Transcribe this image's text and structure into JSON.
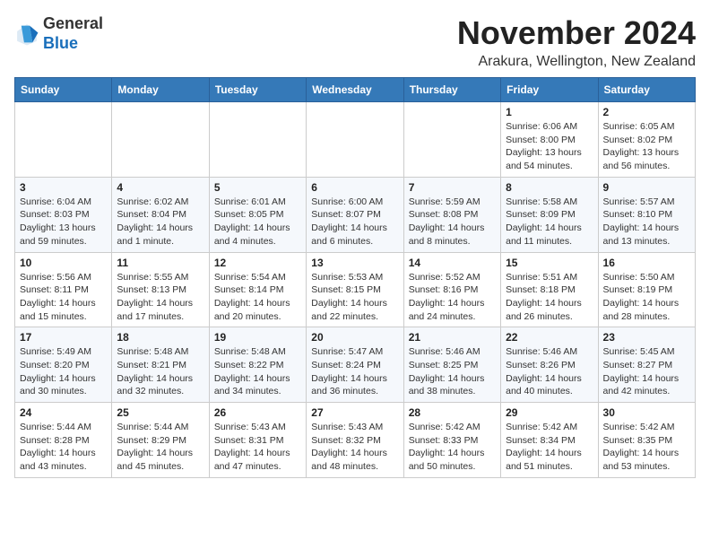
{
  "header": {
    "logo": {
      "line1": "General",
      "line2": "Blue"
    },
    "month": "November 2024",
    "location": "Arakura, Wellington, New Zealand"
  },
  "weekdays": [
    "Sunday",
    "Monday",
    "Tuesday",
    "Wednesday",
    "Thursday",
    "Friday",
    "Saturday"
  ],
  "weeks": [
    [
      {
        "day": "",
        "info": ""
      },
      {
        "day": "",
        "info": ""
      },
      {
        "day": "",
        "info": ""
      },
      {
        "day": "",
        "info": ""
      },
      {
        "day": "",
        "info": ""
      },
      {
        "day": "1",
        "info": "Sunrise: 6:06 AM\nSunset: 8:00 PM\nDaylight: 13 hours and 54 minutes."
      },
      {
        "day": "2",
        "info": "Sunrise: 6:05 AM\nSunset: 8:02 PM\nDaylight: 13 hours and 56 minutes."
      }
    ],
    [
      {
        "day": "3",
        "info": "Sunrise: 6:04 AM\nSunset: 8:03 PM\nDaylight: 13 hours and 59 minutes."
      },
      {
        "day": "4",
        "info": "Sunrise: 6:02 AM\nSunset: 8:04 PM\nDaylight: 14 hours and 1 minute."
      },
      {
        "day": "5",
        "info": "Sunrise: 6:01 AM\nSunset: 8:05 PM\nDaylight: 14 hours and 4 minutes."
      },
      {
        "day": "6",
        "info": "Sunrise: 6:00 AM\nSunset: 8:07 PM\nDaylight: 14 hours and 6 minutes."
      },
      {
        "day": "7",
        "info": "Sunrise: 5:59 AM\nSunset: 8:08 PM\nDaylight: 14 hours and 8 minutes."
      },
      {
        "day": "8",
        "info": "Sunrise: 5:58 AM\nSunset: 8:09 PM\nDaylight: 14 hours and 11 minutes."
      },
      {
        "day": "9",
        "info": "Sunrise: 5:57 AM\nSunset: 8:10 PM\nDaylight: 14 hours and 13 minutes."
      }
    ],
    [
      {
        "day": "10",
        "info": "Sunrise: 5:56 AM\nSunset: 8:11 PM\nDaylight: 14 hours and 15 minutes."
      },
      {
        "day": "11",
        "info": "Sunrise: 5:55 AM\nSunset: 8:13 PM\nDaylight: 14 hours and 17 minutes."
      },
      {
        "day": "12",
        "info": "Sunrise: 5:54 AM\nSunset: 8:14 PM\nDaylight: 14 hours and 20 minutes."
      },
      {
        "day": "13",
        "info": "Sunrise: 5:53 AM\nSunset: 8:15 PM\nDaylight: 14 hours and 22 minutes."
      },
      {
        "day": "14",
        "info": "Sunrise: 5:52 AM\nSunset: 8:16 PM\nDaylight: 14 hours and 24 minutes."
      },
      {
        "day": "15",
        "info": "Sunrise: 5:51 AM\nSunset: 8:18 PM\nDaylight: 14 hours and 26 minutes."
      },
      {
        "day": "16",
        "info": "Sunrise: 5:50 AM\nSunset: 8:19 PM\nDaylight: 14 hours and 28 minutes."
      }
    ],
    [
      {
        "day": "17",
        "info": "Sunrise: 5:49 AM\nSunset: 8:20 PM\nDaylight: 14 hours and 30 minutes."
      },
      {
        "day": "18",
        "info": "Sunrise: 5:48 AM\nSunset: 8:21 PM\nDaylight: 14 hours and 32 minutes."
      },
      {
        "day": "19",
        "info": "Sunrise: 5:48 AM\nSunset: 8:22 PM\nDaylight: 14 hours and 34 minutes."
      },
      {
        "day": "20",
        "info": "Sunrise: 5:47 AM\nSunset: 8:24 PM\nDaylight: 14 hours and 36 minutes."
      },
      {
        "day": "21",
        "info": "Sunrise: 5:46 AM\nSunset: 8:25 PM\nDaylight: 14 hours and 38 minutes."
      },
      {
        "day": "22",
        "info": "Sunrise: 5:46 AM\nSunset: 8:26 PM\nDaylight: 14 hours and 40 minutes."
      },
      {
        "day": "23",
        "info": "Sunrise: 5:45 AM\nSunset: 8:27 PM\nDaylight: 14 hours and 42 minutes."
      }
    ],
    [
      {
        "day": "24",
        "info": "Sunrise: 5:44 AM\nSunset: 8:28 PM\nDaylight: 14 hours and 43 minutes."
      },
      {
        "day": "25",
        "info": "Sunrise: 5:44 AM\nSunset: 8:29 PM\nDaylight: 14 hours and 45 minutes."
      },
      {
        "day": "26",
        "info": "Sunrise: 5:43 AM\nSunset: 8:31 PM\nDaylight: 14 hours and 47 minutes."
      },
      {
        "day": "27",
        "info": "Sunrise: 5:43 AM\nSunset: 8:32 PM\nDaylight: 14 hours and 48 minutes."
      },
      {
        "day": "28",
        "info": "Sunrise: 5:42 AM\nSunset: 8:33 PM\nDaylight: 14 hours and 50 minutes."
      },
      {
        "day": "29",
        "info": "Sunrise: 5:42 AM\nSunset: 8:34 PM\nDaylight: 14 hours and 51 minutes."
      },
      {
        "day": "30",
        "info": "Sunrise: 5:42 AM\nSunset: 8:35 PM\nDaylight: 14 hours and 53 minutes."
      }
    ]
  ]
}
